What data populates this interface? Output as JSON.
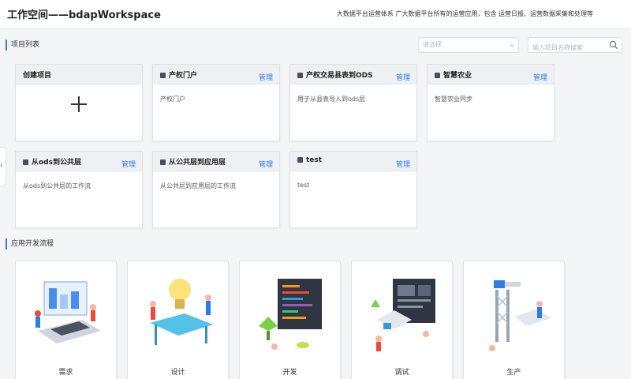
{
  "header": {
    "title": "工作空间——bdapWorkspace",
    "description": "大数据平台运营体系 广大数据平台所有的运营应用，包含 运营日报、运营数据采集和处理等"
  },
  "projects_section": {
    "title": "项目列表",
    "select_placeholder": "请选择",
    "search_placeholder": "输入项目名称搜索"
  },
  "create_card": {
    "title": "创建项目"
  },
  "manage_label": "管理",
  "projects": [
    {
      "title": "产权门户",
      "desc": "产权门户"
    },
    {
      "title": "产权交易县表到ODS",
      "desc": "用于从县表导入到ods层"
    },
    {
      "title": "智慧农业",
      "desc": "智慧农业同步"
    },
    {
      "title": "从ods到公共层",
      "desc": "从ods到公共层的工作流"
    },
    {
      "title": "从公共层到应用层",
      "desc": "从公共层到应用层的工作流"
    },
    {
      "title": "test",
      "desc": "test"
    }
  ],
  "flow_section": {
    "title": "应用开发流程"
  },
  "flow_steps": [
    {
      "label": "需求"
    },
    {
      "label": "设计"
    },
    {
      "label": "开发"
    },
    {
      "label": "调试"
    },
    {
      "label": "生产"
    }
  ],
  "colors": {
    "accent": "#2d7be5",
    "card_header": "#eef0f3",
    "background": "#f4f5f7"
  }
}
